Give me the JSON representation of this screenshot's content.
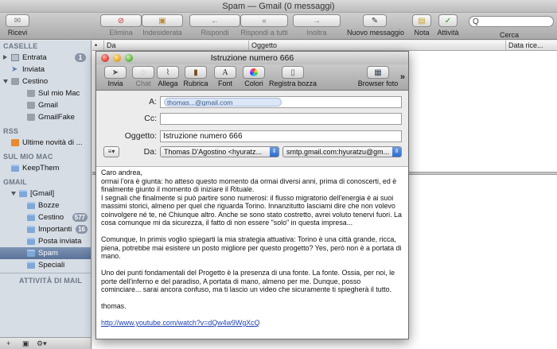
{
  "window": {
    "title": "Spam — Gmail (0 messaggi)"
  },
  "toolbar": {
    "receive": "Ricevi",
    "delete": "Elimina",
    "junk": "Indesiderata",
    "reply": "Rispondi",
    "reply_all": "Rispondi a tutti",
    "forward": "Inoltra",
    "new_message": "Nuovo messaggio",
    "note": "Nota",
    "activity": "Attività",
    "search_label": "Cerca",
    "search_value": "Q"
  },
  "sidebar": {
    "sections": {
      "mailboxes": "CASELLE",
      "rss": "RSS",
      "on_my_mac": "SUL MIO MAC",
      "gmail": "GMAIL",
      "mail_activity": "ATTIVITÀ DI MAIL"
    },
    "inbox": {
      "label": "Entrata",
      "badge": "1"
    },
    "sent": "Inviata",
    "trash": "Cestino",
    "trash_children": [
      "Sul mio Mac",
      "Gmail",
      "GmailFake"
    ],
    "rss_item": "Ultime novità di ...",
    "on_my_mac_item": "KeepThem",
    "gmail_root": "[Gmail]",
    "gmail_children": [
      {
        "label": "Bozze",
        "badge": ""
      },
      {
        "label": "Cestino",
        "badge": "577"
      },
      {
        "label": "Importanti",
        "badge": "16"
      },
      {
        "label": "Posta inviata",
        "badge": ""
      },
      {
        "label": "Spam",
        "badge": ""
      },
      {
        "label": "Speciali",
        "badge": ""
      }
    ],
    "bottom": {
      "add": "+",
      "box": "▣",
      "gear": "⚙▾"
    }
  },
  "message_list": {
    "columns": {
      "bullet": "•",
      "from": "Da",
      "subject": "Oggetto",
      "date": "Data rice..."
    }
  },
  "compose": {
    "title": "Istruzione numero 666",
    "toolbar": {
      "send": "Invia",
      "chat": "Chat",
      "attach": "Allega",
      "address": "Rubrica",
      "fonts": "Font",
      "colors": "Colori",
      "save_draft": "Registra bozza",
      "photo_browser": "Browser foto",
      "more": "»"
    },
    "to_label": "A:",
    "to_value": "thomas...@gmail.com",
    "cc_label": "Cc:",
    "cc_value": "",
    "subject_label": "Oggetto:",
    "subject_value": "Istruzione numero 666",
    "from_label": "Da:",
    "from_value": "Thomas D'Agostino <hyuratz...",
    "smtp_value": "smtp.gmail.com:hyuratzu@gm...",
    "action_menu": "≡▾",
    "body": {
      "p1": "Caro andrea,\normai l'ora è giunta: ho atteso questo momento da ormai diversi anni, prima di conoscerti, ed è finalmente giunto il momento di iniziare il Rituale.\nI segnali che finalmente si può partire sono numerosi: il flusso migratorio dell'energia è ai suoi massimi storici, almeno per quel che riguarda Torino. Innanzitutto lasciami dire che non volevo coinvolgere né te, né Chiunque altro. Anche se sono stato costretto, avrei voluto tenervi fuori. La cosa comunque mi da sicurezza, il fatto di non essere \"solo\" in questa impresa...",
      "p2": "Comunque, In primis voglio spiegarti la mia strategia attuativa: Torino è una città grande, ricca, piena, potrebbe mai esistere un posto migliore per questo progetto? Yes, però non è a portata di mano.",
      "p3": "Uno dei punti fondamentali del Progetto è la presenza di una fonte. La fonte. Ossia, per noi, le porte dell'inferno e del paradiso, A portata di mano, almeno per me. Dunque, posso cominciare... sarai ancora confuso, ma ti lascio un video che sicuramente ti spiegherà il tutto.",
      "p4": "thomas.",
      "link": "http://www.youtube.com/watch?v=dQw4w9WgXcQ"
    }
  }
}
